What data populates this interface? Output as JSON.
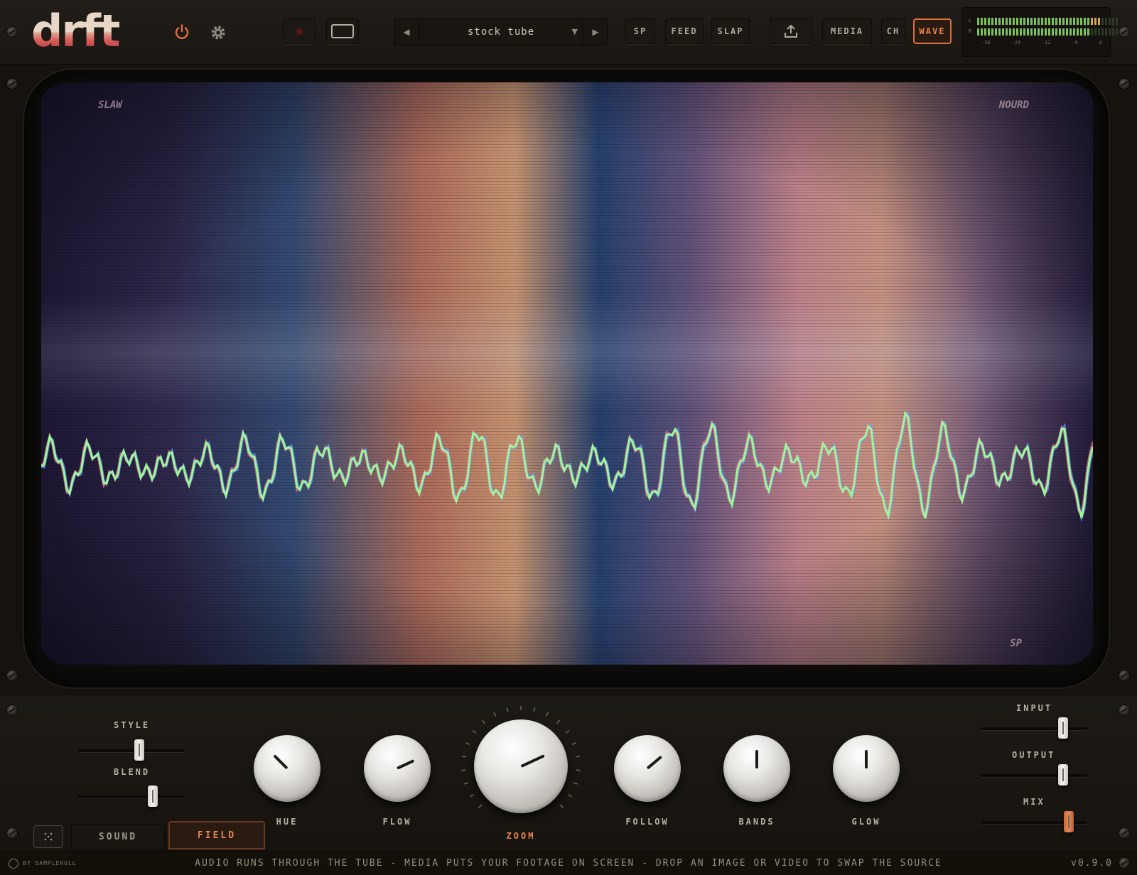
{
  "app": {
    "logo": "drft"
  },
  "topbar": {
    "power_icon": "power-icon",
    "settings_icon": "gear-icon",
    "preset": {
      "name": "stock tube"
    },
    "buttons": {
      "sp": "SP",
      "feed": "FEED",
      "slap": "SLAP",
      "media": "MEDIA",
      "ch": "CH",
      "wave": "WAVE"
    },
    "meter": {
      "left_label": "L",
      "right_label": "R",
      "ticks": [
        "-36",
        "-24",
        "-12",
        "-6",
        "0"
      ],
      "left_level": 0.86,
      "right_level": 0.8
    }
  },
  "screen": {
    "corner_tl": "SLAW",
    "corner_tr": "NOURD",
    "corner_br": "SP"
  },
  "controls": {
    "style_label": "STYLE",
    "style_value": 0.58,
    "blend_label": "BLEND",
    "blend_value": 0.72,
    "knobs": [
      {
        "label": "HUE",
        "angle": -45
      },
      {
        "label": "FLOW",
        "angle": 65
      },
      {
        "label": "ZOOM",
        "angle": 65
      },
      {
        "label": "FOLLOW",
        "angle": 50
      },
      {
        "label": "BANDS",
        "angle": 0
      },
      {
        "label": "GLOW",
        "angle": 0
      }
    ],
    "input_label": "INPUT",
    "input_value": 0.8,
    "output_label": "OUTPUT",
    "output_value": 0.8,
    "mix_label": "MIX",
    "mix_value": 0.86
  },
  "tabs": {
    "sound": "SOUND",
    "field": "FIELD"
  },
  "footer": {
    "by": "BY SAMPLEROLL",
    "message": "AUDIO RUNS THROUGH THE TUBE  -  MEDIA PUTS YOUR FOOTAGE ON SCREEN  -  DROP AN IMAGE OR VIDEO TO SWAP THE SOURCE",
    "version": "v0.9.0"
  },
  "colors": {
    "accent": "#e7854e",
    "wave_green": "#8ff08a",
    "meter_green": "#7fc25a"
  }
}
